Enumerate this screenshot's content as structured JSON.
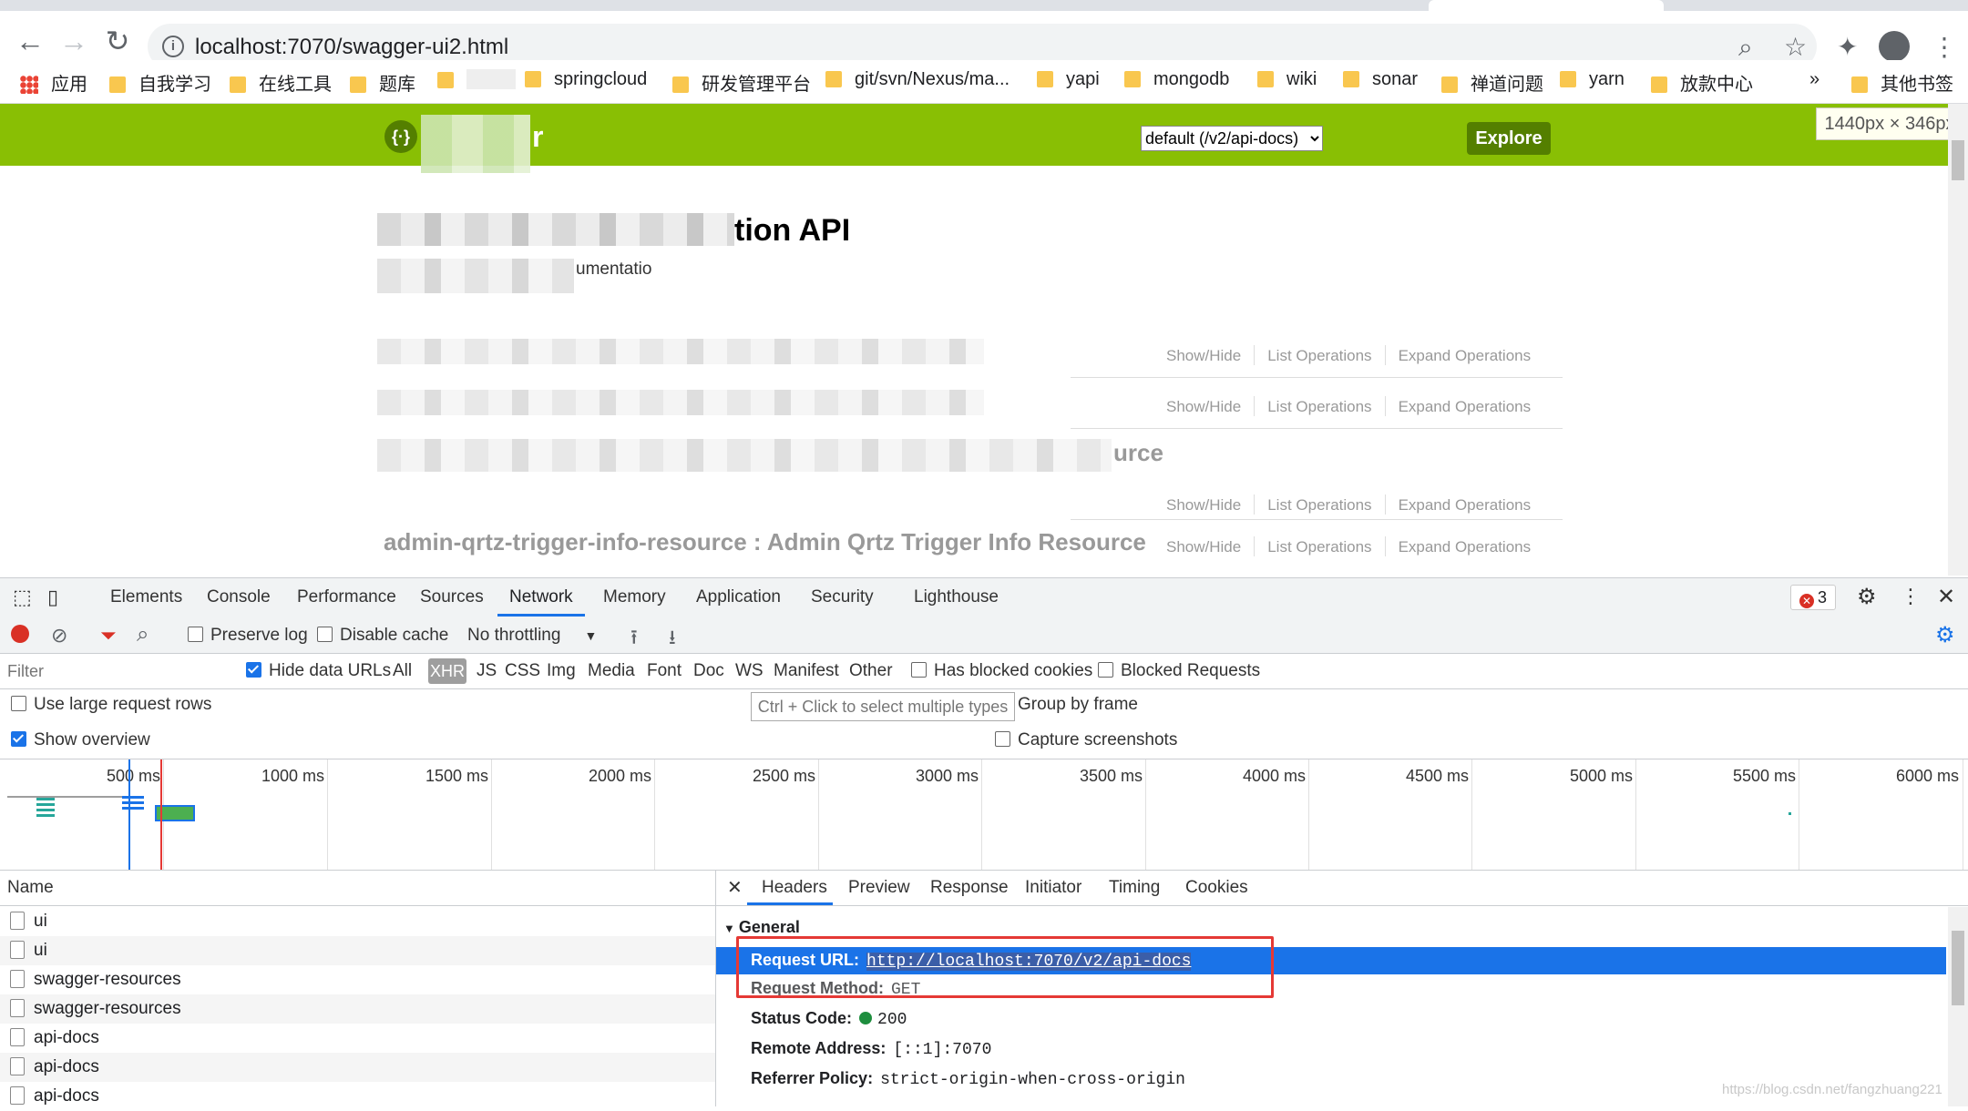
{
  "browser": {
    "url": "localhost:7070/swagger-ui2.html",
    "bookmarks": [
      "应用",
      "自我学习",
      "在线工具",
      "题库",
      "springcloud",
      "研发管理平台",
      "git/svn/Nexus/ma...",
      "yapi",
      "mongodb",
      "wiki",
      "sonar",
      "禅道问题",
      "yarn",
      "放款中心",
      "其他书签"
    ],
    "overflow": "»"
  },
  "swagger": {
    "brand": "r",
    "spec_select": "default (/v2/api-docs)",
    "explore_label": "Explore",
    "dimension_tip": "1440px × 346px",
    "title_fragment": "tion API",
    "subtitle_fragment": "umentatio",
    "resource_suffix": "urce",
    "last_resource": "admin-qrtz-trigger-info-resource : Admin Qrtz Trigger Info Resource",
    "ops": {
      "show_hide": "Show/Hide",
      "list": "List Operations",
      "expand": "Expand Operations"
    }
  },
  "devtools": {
    "tabs": [
      "Elements",
      "Console",
      "Performance",
      "Sources",
      "Network",
      "Memory",
      "Application",
      "Security",
      "Lighthouse"
    ],
    "active_tab": "Network",
    "error_count": "3",
    "toolbar": {
      "preserve_log": "Preserve log",
      "disable_cache": "Disable cache",
      "throttling": "No throttling"
    },
    "filter": {
      "placeholder": "Filter",
      "hide_data_urls": "Hide data URLs",
      "types": [
        "All",
        "XHR",
        "JS",
        "CSS",
        "Img",
        "Media",
        "Font",
        "Doc",
        "WS",
        "Manifest",
        "Other"
      ],
      "active_type": "XHR",
      "has_blocked_cookies": "Has blocked cookies",
      "blocked_requests": "Blocked Requests"
    },
    "options": {
      "large_rows": "Use large request rows",
      "show_overview": "Show overview",
      "group_by_frame": "Group by frame",
      "capture_screenshots": "Capture screenshots",
      "tooltip": "Ctrl + Click to select multiple types"
    },
    "timeline_ticks": [
      "500 ms",
      "1000 ms",
      "1500 ms",
      "2000 ms",
      "2500 ms",
      "3000 ms",
      "3500 ms",
      "4000 ms",
      "4500 ms",
      "5000 ms",
      "5500 ms",
      "6000 ms"
    ],
    "name_header": "Name",
    "requests": [
      "ui",
      "ui",
      "swagger-resources",
      "swagger-resources",
      "api-docs",
      "api-docs",
      "api-docs"
    ],
    "detail_tabs": [
      "Headers",
      "Preview",
      "Response",
      "Initiator",
      "Timing",
      "Cookies"
    ],
    "active_detail_tab": "Headers",
    "general": {
      "section": "General",
      "request_url_label": "Request URL:",
      "request_url": "http://localhost:7070/v2/api-docs",
      "request_method_label": "Request Method:",
      "request_method": "GET",
      "status_label": "Status Code:",
      "status": "200",
      "status_color": "#1e8e3e",
      "remote_label": "Remote Address:",
      "remote": "[::1]:7070",
      "referrer_label": "Referrer Policy:",
      "referrer": "strict-origin-when-cross-origin"
    },
    "watermark": "https://blog.csdn.net/fangzhuang221"
  }
}
